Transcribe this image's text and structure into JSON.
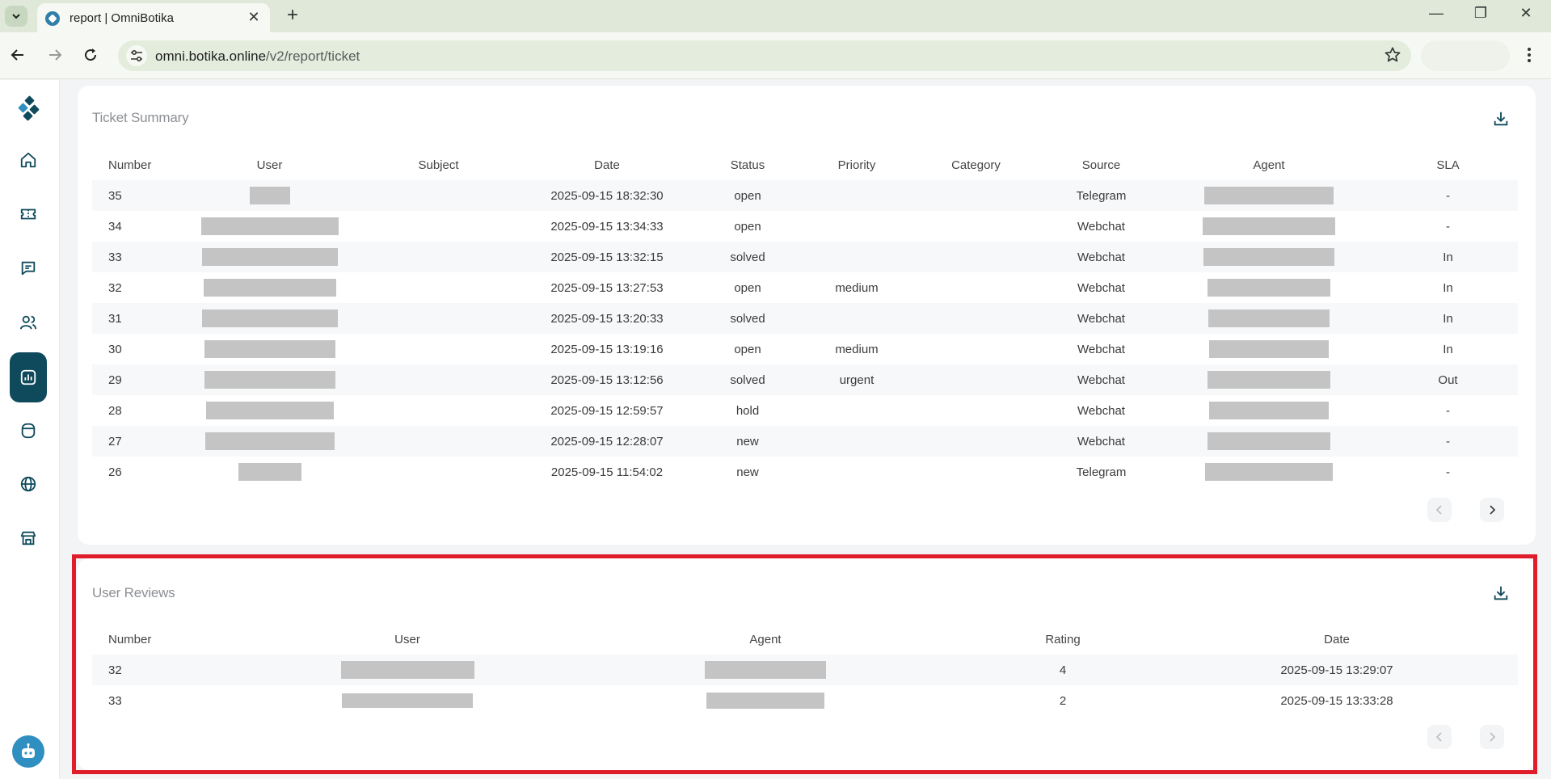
{
  "browser": {
    "tab_title": "report | OmniBotika",
    "tab_close": "✕",
    "new_tab": "+",
    "url_host": "omni.botika.online",
    "url_path": "/v2/report/ticket",
    "window_minimize": "—",
    "window_restore": "❐",
    "window_close": "✕"
  },
  "sidebar": {
    "items": [
      {
        "icon": "home-icon"
      },
      {
        "icon": "ticket-icon"
      },
      {
        "icon": "chat-icon"
      },
      {
        "icon": "users-icon"
      },
      {
        "icon": "report-icon",
        "active": true
      },
      {
        "icon": "database-icon"
      },
      {
        "icon": "globe-icon"
      },
      {
        "icon": "store-icon"
      }
    ]
  },
  "ticket_summary": {
    "title": "Ticket Summary",
    "columns": [
      "Number",
      "User",
      "Subject",
      "Date",
      "Status",
      "Priority",
      "Category",
      "Source",
      "Agent",
      "SLA"
    ],
    "rows": [
      {
        "number": "35",
        "date": "2025-09-15 18:32:30",
        "status": "open",
        "priority": "",
        "source": "Telegram",
        "sla": "-"
      },
      {
        "number": "34",
        "date": "2025-09-15 13:34:33",
        "status": "open",
        "priority": "",
        "source": "Webchat",
        "sla": "-"
      },
      {
        "number": "33",
        "date": "2025-09-15 13:32:15",
        "status": "solved",
        "priority": "",
        "source": "Webchat",
        "sla": "In"
      },
      {
        "number": "32",
        "date": "2025-09-15 13:27:53",
        "status": "open",
        "priority": "medium",
        "source": "Webchat",
        "sla": "In"
      },
      {
        "number": "31",
        "date": "2025-09-15 13:20:33",
        "status": "solved",
        "priority": "",
        "source": "Webchat",
        "sla": "In"
      },
      {
        "number": "30",
        "date": "2025-09-15 13:19:16",
        "status": "open",
        "priority": "medium",
        "source": "Webchat",
        "sla": "In"
      },
      {
        "number": "29",
        "date": "2025-09-15 13:12:56",
        "status": "solved",
        "priority": "urgent",
        "source": "Webchat",
        "sla": "Out"
      },
      {
        "number": "28",
        "date": "2025-09-15 12:59:57",
        "status": "hold",
        "priority": "",
        "source": "Webchat",
        "sla": "-"
      },
      {
        "number": "27",
        "date": "2025-09-15 12:28:07",
        "status": "new",
        "priority": "",
        "source": "Webchat",
        "sla": "-"
      },
      {
        "number": "26",
        "date": "2025-09-15 11:54:02",
        "status": "new",
        "priority": "",
        "source": "Telegram",
        "sla": "-"
      }
    ]
  },
  "user_reviews": {
    "title": "User Reviews",
    "columns": [
      "Number",
      "User",
      "Agent",
      "Rating",
      "Date"
    ],
    "rows": [
      {
        "number": "32",
        "rating": "4",
        "date": "2025-09-15 13:29:07"
      },
      {
        "number": "33",
        "rating": "2",
        "date": "2025-09-15 13:33:28"
      }
    ]
  },
  "colors": {
    "sidebar_active": "#0f4a5c",
    "highlight_border": "#e01e2b",
    "redacted": "#c4c4c4"
  }
}
